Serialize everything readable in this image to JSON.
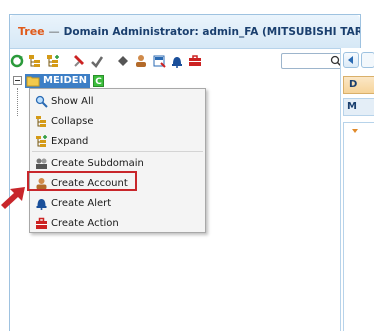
{
  "window": {
    "title_tree": "Tree",
    "title_separator": "—",
    "title_main": "Domain Administrator: admin_FA (MITSUBISHI TARO)"
  },
  "toolbar": {
    "buttons": [
      {
        "name": "refresh-icon",
        "color": "#2a9a3a"
      },
      {
        "name": "collapse-tree-icon",
        "color": "#d49a16"
      },
      {
        "name": "expand-tree-icon",
        "color": "#d49a16"
      },
      {
        "name": "mark-icon",
        "color": "#c22"
      },
      {
        "name": "unmark-icon",
        "color": "#6a6a6a"
      },
      {
        "name": "create-subdomain-icon",
        "color": "#555"
      },
      {
        "name": "create-account-icon",
        "color": "#b36a2a"
      },
      {
        "name": "create-document-icon",
        "color": "#2a6ab3"
      },
      {
        "name": "create-alert-icon",
        "color": "#1a4f9a"
      },
      {
        "name": "create-action-icon",
        "color": "#c22"
      }
    ],
    "search_placeholder": ""
  },
  "tree": {
    "root_label": "MEIDEN",
    "root_badge": "C"
  },
  "context_menu": {
    "items": [
      {
        "label": "Show All",
        "icon": "magnifier-icon"
      },
      {
        "label": "Collapse",
        "icon": "collapse-icon"
      },
      {
        "label": "Expand",
        "icon": "expand-icon"
      },
      {
        "label": "Create Subdomain",
        "icon": "subdomain-icon"
      },
      {
        "label": "Create Account",
        "icon": "account-icon"
      },
      {
        "label": "Create Alert",
        "icon": "alert-bell-icon"
      },
      {
        "label": "Create Action",
        "icon": "action-icon"
      }
    ],
    "highlighted": "Create Account"
  },
  "right_panel": {
    "tab1": "D",
    "tab2": "M"
  },
  "colors": {
    "accent_orange": "#e05a1a",
    "title_blue": "#1a3f6e",
    "node_blue": "#3d7fc6",
    "badge_green": "#3bbd3b",
    "highlight_red": "#c8262b"
  }
}
